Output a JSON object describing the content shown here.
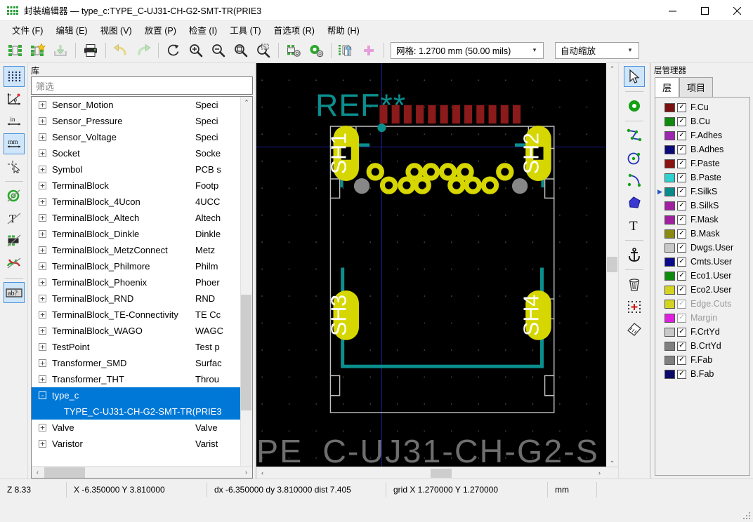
{
  "window": {
    "title": "封装编辑器 — type_c:TYPE_C-UJ31-CH-G2-SMT-TR(PRIE3",
    "app_icon": "footprint-editor-icon",
    "controls": {
      "minimize": "—",
      "maximize": "▢",
      "close": "✕"
    }
  },
  "menubar": {
    "items": [
      {
        "label": "文件 (F)",
        "name": "menu-file"
      },
      {
        "label": "编辑 (E)",
        "name": "menu-edit"
      },
      {
        "label": "视图 (V)",
        "name": "menu-view"
      },
      {
        "label": "放置 (P)",
        "name": "menu-place"
      },
      {
        "label": "检查 (I)",
        "name": "menu-inspect"
      },
      {
        "label": "工具 (T)",
        "name": "menu-tools"
      },
      {
        "label": "首选项 (R)",
        "name": "menu-preferences"
      },
      {
        "label": "帮助 (H)",
        "name": "menu-help"
      }
    ]
  },
  "toolbar": {
    "buttons": [
      "new-footprint-icon",
      "new-footprint-from-wizard-icon",
      "save-to-library-icon",
      "print-icon",
      "undo-icon",
      "redo-icon",
      "refresh-icon",
      "zoom-in-icon",
      "zoom-out-icon",
      "zoom-fit-icon",
      "zoom-area-icon",
      "footprint-properties-icon",
      "pad-properties-icon",
      "load-from-board-icon",
      "insert-into-board-icon"
    ],
    "grid_select": {
      "value": "网格: 1.2700 mm (50.00 mils)",
      "arrow": "▾"
    },
    "zoom_select": {
      "value": "自动缩放",
      "arrow": "▾"
    }
  },
  "left_toolbar": {
    "buttons": [
      {
        "name": "toggle-grid-icon",
        "active": false
      },
      {
        "name": "polar-coordinates-icon",
        "active": false
      },
      {
        "name": "units-inches-icon",
        "active": false
      },
      {
        "name": "units-millimeters-icon",
        "active": true
      },
      {
        "name": "full-window-crosshair-icon",
        "active": false
      },
      {
        "name": "show-pads-sketch-icon",
        "active": false
      },
      {
        "name": "show-text-sketch-icon",
        "active": false
      },
      {
        "name": "show-graphics-sketch-icon",
        "active": false
      },
      {
        "name": "high-contrast-mode-icon",
        "active": false
      },
      {
        "name": "show-pad-numbers-icon",
        "active": true
      }
    ]
  },
  "right_toolbar": {
    "buttons": [
      {
        "name": "select-tool-icon",
        "active": true
      },
      {
        "name": "add-pad-tool-icon",
        "active": false
      },
      {
        "name": "draw-line-tool-icon",
        "active": false
      },
      {
        "name": "draw-circle-tool-icon",
        "active": false
      },
      {
        "name": "draw-arc-tool-icon",
        "active": false
      },
      {
        "name": "draw-polygon-tool-icon",
        "active": false
      },
      {
        "name": "add-text-tool-icon",
        "active": false
      },
      {
        "name": "set-anchor-tool-icon",
        "active": false
      },
      {
        "name": "delete-tool-icon",
        "active": false
      },
      {
        "name": "set-grid-origin-tool-icon",
        "active": false
      },
      {
        "name": "measure-tool-icon",
        "active": false
      }
    ]
  },
  "library_panel": {
    "caption": "库",
    "filter_placeholder": "筛选",
    "filter_value": "",
    "tree": [
      {
        "name": "Sensor_Motion",
        "desc": "Speci",
        "expander": "+",
        "selected": false
      },
      {
        "name": "Sensor_Pressure",
        "desc": "Speci",
        "expander": "+",
        "selected": false
      },
      {
        "name": "Sensor_Voltage",
        "desc": "Speci",
        "expander": "+",
        "selected": false
      },
      {
        "name": "Socket",
        "desc": "Socke",
        "expander": "+",
        "selected": false
      },
      {
        "name": "Symbol",
        "desc": "PCB s",
        "expander": "+",
        "selected": false
      },
      {
        "name": "TerminalBlock",
        "desc": "Footp",
        "expander": "+",
        "selected": false
      },
      {
        "name": "TerminalBlock_4Ucon",
        "desc": "4UCC",
        "expander": "+",
        "selected": false
      },
      {
        "name": "TerminalBlock_Altech",
        "desc": "Altech",
        "expander": "+",
        "selected": false
      },
      {
        "name": "TerminalBlock_Dinkle",
        "desc": "Dinkle",
        "expander": "+",
        "selected": false
      },
      {
        "name": "TerminalBlock_MetzConnect",
        "desc": "Metz",
        "expander": "+",
        "selected": false
      },
      {
        "name": "TerminalBlock_Philmore",
        "desc": "Philm",
        "expander": "+",
        "selected": false
      },
      {
        "name": "TerminalBlock_Phoenix",
        "desc": "Phoer",
        "expander": "+",
        "selected": false
      },
      {
        "name": "TerminalBlock_RND",
        "desc": "RND",
        "expander": "+",
        "selected": false
      },
      {
        "name": "TerminalBlock_TE-Connectivity",
        "desc": "TE Cc",
        "expander": "+",
        "selected": false
      },
      {
        "name": "TerminalBlock_WAGO",
        "desc": "WAGC",
        "expander": "+",
        "selected": false
      },
      {
        "name": "TestPoint",
        "desc": "Test p",
        "expander": "+",
        "selected": false
      },
      {
        "name": "Transformer_SMD",
        "desc": "Surfac",
        "expander": "+",
        "selected": false
      },
      {
        "name": "Transformer_THT",
        "desc": "Throu",
        "expander": "+",
        "selected": false
      },
      {
        "name": "type_c",
        "desc": "",
        "expander": "-",
        "selected": true
      },
      {
        "child_name": "TYPE_C-UJ31-CH-G2-SMT-TR(PRIE3",
        "selected": true,
        "is_child": true
      },
      {
        "name": "Valve",
        "desc": "Valve",
        "expander": "+",
        "selected": false
      },
      {
        "name": "Varistor",
        "desc": "Varist",
        "expander": "+",
        "selected": false
      }
    ],
    "scroll_left_arrow": "‹",
    "scroll_right_arrow": "›",
    "scroll_up_arrow": "⌃",
    "scroll_down_arrow": "⌄"
  },
  "canvas": {
    "background": "#000000",
    "reference_text": "REF**",
    "value_text_clipped": "PE_C-UJ31-CH-G2-S",
    "pads": [
      {
        "label": "SH1",
        "type": "smd-oval",
        "color": "#d4d400"
      },
      {
        "label": "SH2",
        "type": "smd-oval",
        "color": "#d4d400"
      },
      {
        "label": "SH3",
        "type": "smd-oval",
        "color": "#d4d400"
      },
      {
        "label": "SH4",
        "type": "smd-oval",
        "color": "#d4d400"
      }
    ],
    "smd_pad_count": 12,
    "smd_pad_color": "#8b1a1a",
    "tht_pad_color": "#d4d400",
    "npth_pad_color": "#808080",
    "silkscreen_color": "#008484",
    "courtyard_color": "#c8c8c8",
    "axis_color": "#0000a0",
    "grid_dot_color": "#555555",
    "scroll_left_arrow": "‹",
    "scroll_right_arrow": "›",
    "scroll_up_arrow": "⌃",
    "scroll_down_arrow": "⌄"
  },
  "layer_panel": {
    "caption": "层管理器",
    "tabs": [
      {
        "label": "层",
        "active": true,
        "name": "tab-layers"
      },
      {
        "label": "项目",
        "active": false,
        "name": "tab-items"
      }
    ],
    "layers": [
      {
        "name": "F.Cu",
        "color": "#7b1010",
        "checked": true,
        "active": false,
        "dim": false
      },
      {
        "name": "B.Cu",
        "color": "#0f8a0f",
        "checked": true,
        "active": false,
        "dim": false
      },
      {
        "name": "F.Adhes",
        "color": "#9c27b0",
        "checked": true,
        "active": false,
        "dim": false
      },
      {
        "name": "B.Adhes",
        "color": "#0a0a7a",
        "checked": true,
        "active": false,
        "dim": false
      },
      {
        "name": "F.Paste",
        "color": "#8b1212",
        "checked": true,
        "active": false,
        "dim": false
      },
      {
        "name": "B.Paste",
        "color": "#2fd0d0",
        "checked": true,
        "active": false,
        "dim": false
      },
      {
        "name": "F.SilkS",
        "color": "#0a8a8a",
        "checked": true,
        "active": true,
        "dim": false
      },
      {
        "name": "B.SilkS",
        "color": "#a020a0",
        "checked": true,
        "active": false,
        "dim": false
      },
      {
        "name": "F.Mask",
        "color": "#a020a0",
        "checked": true,
        "active": false,
        "dim": false
      },
      {
        "name": "B.Mask",
        "color": "#8a8a10",
        "checked": true,
        "active": false,
        "dim": false
      },
      {
        "name": "Dwgs.User",
        "color": "#c8c8c8",
        "checked": true,
        "active": false,
        "dim": false
      },
      {
        "name": "Cmts.User",
        "color": "#0a0a8a",
        "checked": true,
        "active": false,
        "dim": false
      },
      {
        "name": "Eco1.User",
        "color": "#0f8a0f",
        "checked": true,
        "active": false,
        "dim": false
      },
      {
        "name": "Eco2.User",
        "color": "#d4d420",
        "checked": true,
        "active": false,
        "dim": false
      },
      {
        "name": "Edge.Cuts",
        "color": "#d4d420",
        "checked": true,
        "active": false,
        "dim": true
      },
      {
        "name": "Margin",
        "color": "#e020e0",
        "checked": true,
        "active": false,
        "dim": true
      },
      {
        "name": "F.CrtYd",
        "color": "#c8c8c8",
        "checked": true,
        "active": false,
        "dim": false
      },
      {
        "name": "B.CrtYd",
        "color": "#808080",
        "checked": true,
        "active": false,
        "dim": false
      },
      {
        "name": "F.Fab",
        "color": "#808080",
        "checked": true,
        "active": false,
        "dim": false
      },
      {
        "name": "B.Fab",
        "color": "#0a0a6a",
        "checked": true,
        "active": false,
        "dim": false
      }
    ],
    "check_glyph": "✓"
  },
  "statusbar": {
    "zoom": "Z 8.33",
    "coords": "X -6.350000  Y 3.810000",
    "delta": "dx -6.350000  dy 3.810000  dist 7.405",
    "grid": "grid X 1.270000  Y 1.270000",
    "units": "mm"
  }
}
